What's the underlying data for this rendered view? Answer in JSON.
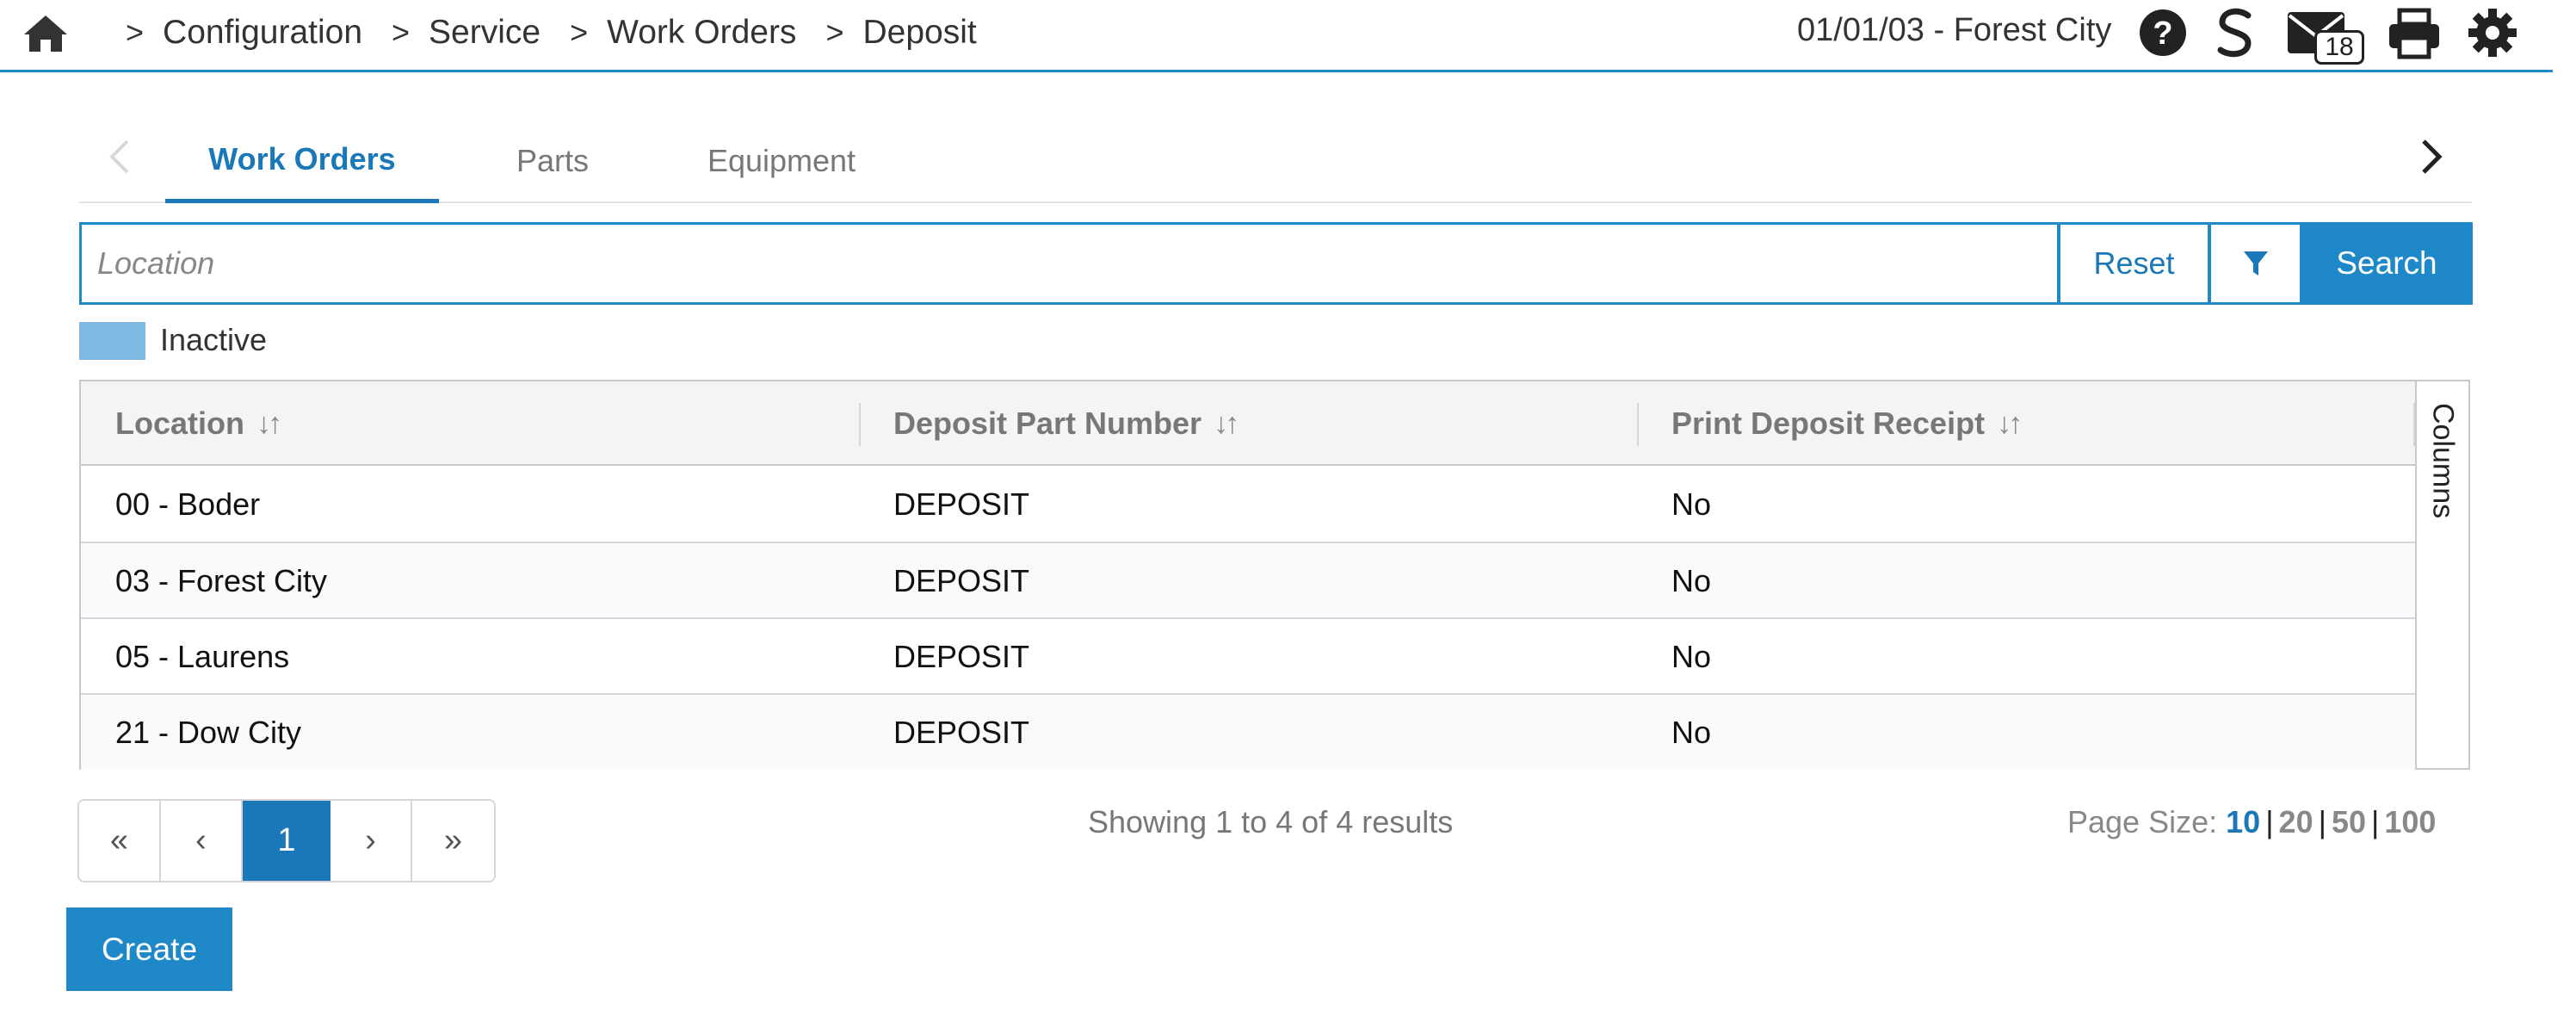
{
  "breadcrumb": {
    "items": [
      "Configuration",
      "Service",
      "Work Orders",
      "Deposit"
    ],
    "separator": ">"
  },
  "header": {
    "location": "01/01/03 - Forest City",
    "mail_count": "18",
    "icons": [
      "home-icon",
      "help-icon",
      "s-logo-icon",
      "mail-icon",
      "print-icon",
      "gear-icon"
    ]
  },
  "tabs": [
    {
      "label": "Work Orders",
      "active": true
    },
    {
      "label": "Parts",
      "active": false
    },
    {
      "label": "Equipment",
      "active": false
    }
  ],
  "search": {
    "placeholder": "Location",
    "value": "",
    "reset_label": "Reset",
    "search_label": "Search"
  },
  "legend": {
    "label": "Inactive",
    "color": "#7fb8e0"
  },
  "table": {
    "columns": [
      "Location",
      "Deposit Part Number",
      "Print Deposit Receipt"
    ],
    "sort_glyph": "↓↑",
    "rows": [
      [
        "00 - Boder",
        "DEPOSIT",
        "No"
      ],
      [
        "03 - Forest City",
        "DEPOSIT",
        "No"
      ],
      [
        "05 - Laurens",
        "DEPOSIT",
        "No"
      ],
      [
        "21 - Dow City",
        "DEPOSIT",
        "No"
      ]
    ],
    "columns_toggle_label": "Columns"
  },
  "pagination": {
    "first": "«",
    "prev": "‹",
    "current": "1",
    "next": "›",
    "last": "»",
    "summary": "Showing 1 to 4 of 4 results",
    "page_size_label": "Page Size:",
    "page_sizes": [
      "10",
      "20",
      "50",
      "100"
    ],
    "page_size_selected": "10"
  },
  "actions": {
    "create_label": "Create"
  },
  "colors": {
    "accent": "#1e88c8",
    "active_text": "#1a78b8"
  }
}
